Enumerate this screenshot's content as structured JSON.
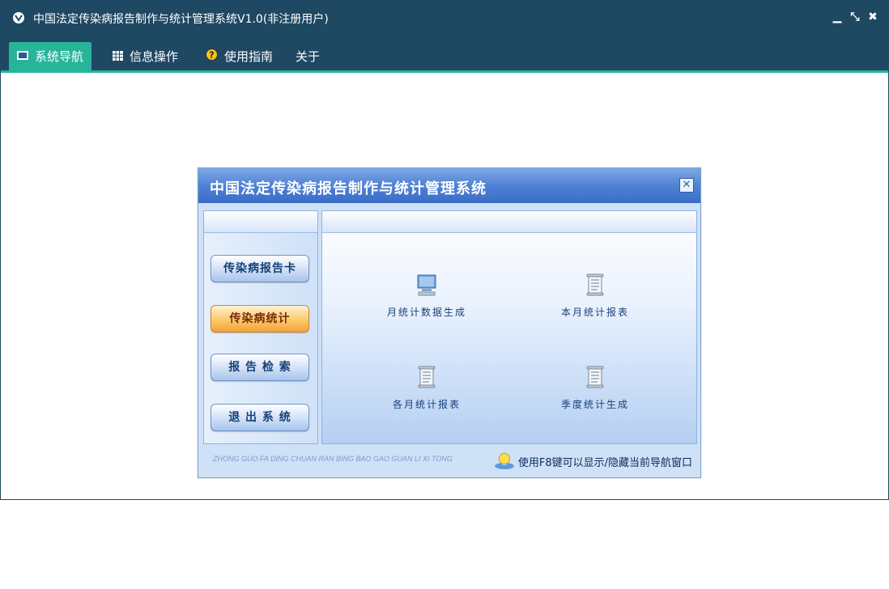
{
  "window": {
    "title": "中国法定传染病报告制作与统计管理系统V1.0(非注册用户)",
    "controls": {
      "minimize": "▁",
      "restore": "⤡",
      "close": "✖"
    }
  },
  "menu": {
    "tabs": [
      {
        "label": "系统导航",
        "icon": "monitor-icon",
        "active": true
      },
      {
        "label": "信息操作",
        "icon": "grid-icon",
        "active": false
      },
      {
        "label": "使用指南",
        "icon": "help-icon",
        "active": false
      },
      {
        "label": "关于",
        "icon": "",
        "active": false
      }
    ]
  },
  "dialog": {
    "title": "中国法定传染病报告制作与统计管理系统",
    "close_label": "✕",
    "nav_buttons": [
      {
        "label": "传染病报告卡",
        "active": false
      },
      {
        "label": "传染病统计",
        "active": true
      },
      {
        "label": "报 告 检 索",
        "active": false
      },
      {
        "label": "退 出 系 统",
        "active": false
      }
    ],
    "tiles": [
      {
        "label": "月统计数据生成",
        "icon": "computer-icon"
      },
      {
        "label": "本月统计报表",
        "icon": "scroll-icon"
      },
      {
        "label": "各月统计报表",
        "icon": "scroll-icon"
      },
      {
        "label": "季度统计生成",
        "icon": "scroll-icon"
      }
    ],
    "footer": {
      "pinyin": "ZHONG GUO FA DING CHUAN RAN BING BAO GAO GUAN LI XI TONG",
      "tip": "使用F8键可以显示/隐藏当前导航窗口"
    }
  },
  "colors": {
    "titlebar": "#1f4863",
    "accent": "#27b49b",
    "dialog_title": "#4f82d4"
  }
}
